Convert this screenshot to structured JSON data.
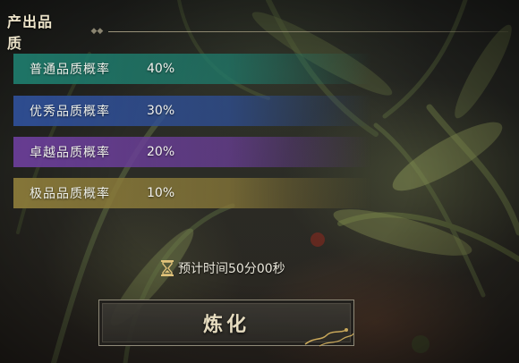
{
  "header": {
    "title": "产出品质",
    "ornament": "◆◆"
  },
  "quality_rows": [
    {
      "label": "普通品质概率",
      "value": "40%",
      "color": "#1f7a6b"
    },
    {
      "label": "优秀品质概率",
      "value": "30%",
      "color": "#2f4f96"
    },
    {
      "label": "卓越品质概率",
      "value": "20%",
      "color": "#6a3e98"
    },
    {
      "label": "极品品质概率",
      "value": "10%",
      "color": "#8a7a3a"
    }
  ],
  "estimate": {
    "icon": "hourglass-icon",
    "text": "预计时间50分00秒"
  },
  "refine_button": {
    "label": "炼化"
  }
}
